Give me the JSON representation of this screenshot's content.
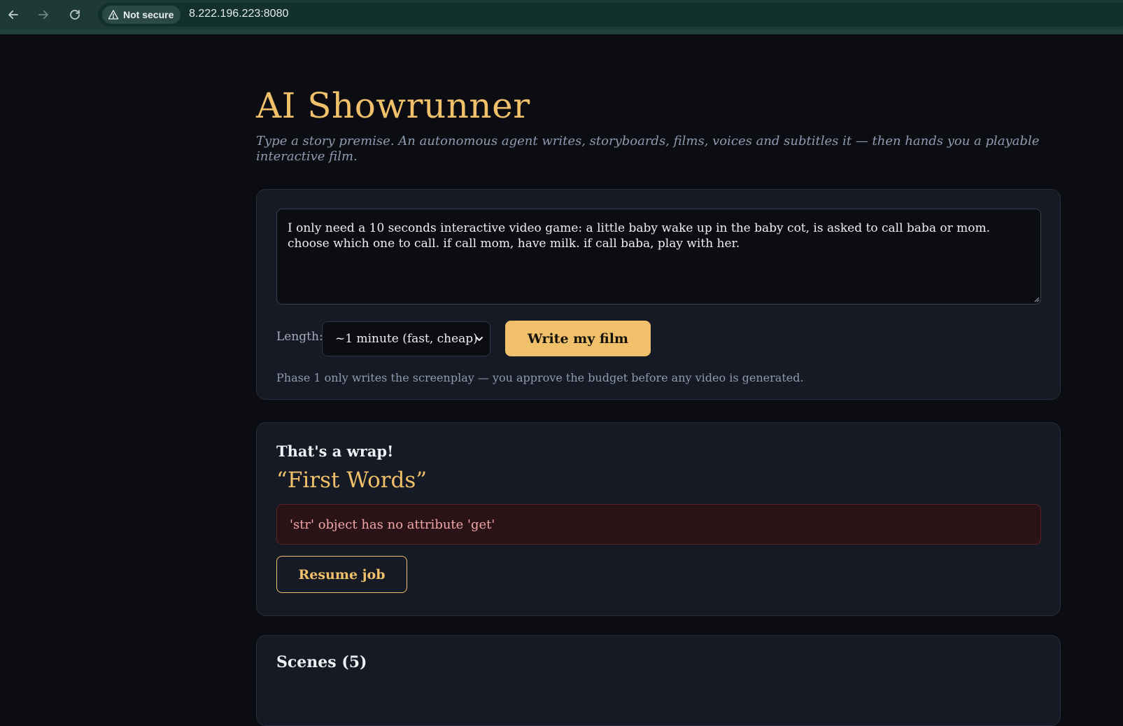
{
  "browser": {
    "security_label": "Not secure",
    "url": "8.222.196.223:8080"
  },
  "header": {
    "title": "AI Showrunner",
    "subtitle": "Type a story premise. An autonomous agent writes, storyboards, films, voices and subtitles it — then hands you a playable interactive film."
  },
  "composer": {
    "premise_value": "I only need a 10 seconds interactive video game: a little baby wake up in the baby cot, is asked to call baba or mom. choose which one to call. if call mom, have milk. if call baba, play with her.",
    "length_label": "Length:",
    "length_selected": "~1 minute (fast, cheap)",
    "write_button": "Write my film",
    "hint": "Phase 1 only writes the screenplay — you approve the budget before any video is generated."
  },
  "result": {
    "heading": "That's a wrap!",
    "film_title": "“First Words”",
    "error": "'str' object has no attribute 'get'",
    "resume_button": "Resume job"
  },
  "scenes": {
    "heading": "Scenes (5)"
  },
  "colors": {
    "accent": "#f0c06a",
    "background": "#0b0d12",
    "card": "#161a24",
    "error_bg": "#2a1316",
    "error_text": "#f2a6a8"
  },
  "icons": [
    "back-arrow-icon",
    "forward-arrow-icon",
    "reload-icon",
    "warning-triangle-icon",
    "chevron-down-icon"
  ]
}
